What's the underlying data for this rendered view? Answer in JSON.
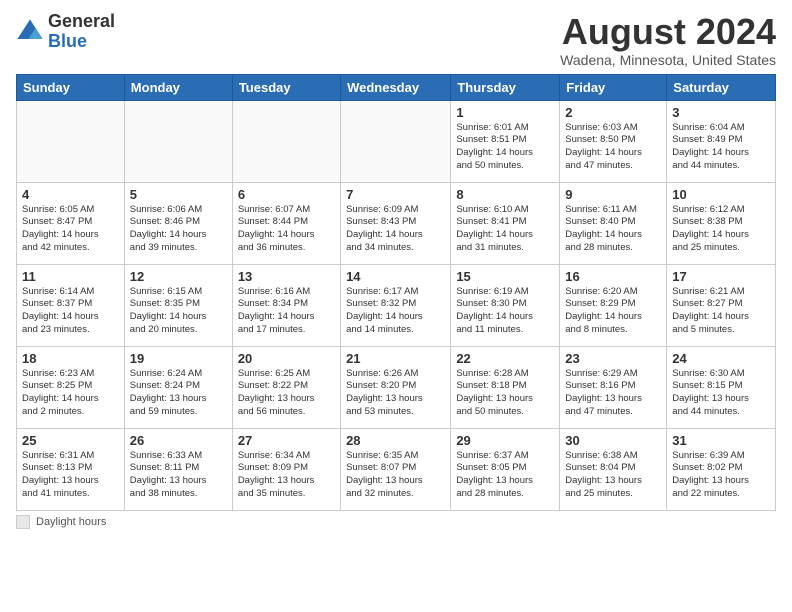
{
  "header": {
    "logo_general": "General",
    "logo_blue": "Blue",
    "month_title": "August 2024",
    "location": "Wadena, Minnesota, United States"
  },
  "days_of_week": [
    "Sunday",
    "Monday",
    "Tuesday",
    "Wednesday",
    "Thursday",
    "Friday",
    "Saturday"
  ],
  "footer": {
    "label": "Daylight hours"
  },
  "weeks": [
    [
      {
        "day": "",
        "info": ""
      },
      {
        "day": "",
        "info": ""
      },
      {
        "day": "",
        "info": ""
      },
      {
        "day": "",
        "info": ""
      },
      {
        "day": "1",
        "info": "Sunrise: 6:01 AM\nSunset: 8:51 PM\nDaylight: 14 hours\nand 50 minutes."
      },
      {
        "day": "2",
        "info": "Sunrise: 6:03 AM\nSunset: 8:50 PM\nDaylight: 14 hours\nand 47 minutes."
      },
      {
        "day": "3",
        "info": "Sunrise: 6:04 AM\nSunset: 8:49 PM\nDaylight: 14 hours\nand 44 minutes."
      }
    ],
    [
      {
        "day": "4",
        "info": "Sunrise: 6:05 AM\nSunset: 8:47 PM\nDaylight: 14 hours\nand 42 minutes."
      },
      {
        "day": "5",
        "info": "Sunrise: 6:06 AM\nSunset: 8:46 PM\nDaylight: 14 hours\nand 39 minutes."
      },
      {
        "day": "6",
        "info": "Sunrise: 6:07 AM\nSunset: 8:44 PM\nDaylight: 14 hours\nand 36 minutes."
      },
      {
        "day": "7",
        "info": "Sunrise: 6:09 AM\nSunset: 8:43 PM\nDaylight: 14 hours\nand 34 minutes."
      },
      {
        "day": "8",
        "info": "Sunrise: 6:10 AM\nSunset: 8:41 PM\nDaylight: 14 hours\nand 31 minutes."
      },
      {
        "day": "9",
        "info": "Sunrise: 6:11 AM\nSunset: 8:40 PM\nDaylight: 14 hours\nand 28 minutes."
      },
      {
        "day": "10",
        "info": "Sunrise: 6:12 AM\nSunset: 8:38 PM\nDaylight: 14 hours\nand 25 minutes."
      }
    ],
    [
      {
        "day": "11",
        "info": "Sunrise: 6:14 AM\nSunset: 8:37 PM\nDaylight: 14 hours\nand 23 minutes."
      },
      {
        "day": "12",
        "info": "Sunrise: 6:15 AM\nSunset: 8:35 PM\nDaylight: 14 hours\nand 20 minutes."
      },
      {
        "day": "13",
        "info": "Sunrise: 6:16 AM\nSunset: 8:34 PM\nDaylight: 14 hours\nand 17 minutes."
      },
      {
        "day": "14",
        "info": "Sunrise: 6:17 AM\nSunset: 8:32 PM\nDaylight: 14 hours\nand 14 minutes."
      },
      {
        "day": "15",
        "info": "Sunrise: 6:19 AM\nSunset: 8:30 PM\nDaylight: 14 hours\nand 11 minutes."
      },
      {
        "day": "16",
        "info": "Sunrise: 6:20 AM\nSunset: 8:29 PM\nDaylight: 14 hours\nand 8 minutes."
      },
      {
        "day": "17",
        "info": "Sunrise: 6:21 AM\nSunset: 8:27 PM\nDaylight: 14 hours\nand 5 minutes."
      }
    ],
    [
      {
        "day": "18",
        "info": "Sunrise: 6:23 AM\nSunset: 8:25 PM\nDaylight: 14 hours\nand 2 minutes."
      },
      {
        "day": "19",
        "info": "Sunrise: 6:24 AM\nSunset: 8:24 PM\nDaylight: 13 hours\nand 59 minutes."
      },
      {
        "day": "20",
        "info": "Sunrise: 6:25 AM\nSunset: 8:22 PM\nDaylight: 13 hours\nand 56 minutes."
      },
      {
        "day": "21",
        "info": "Sunrise: 6:26 AM\nSunset: 8:20 PM\nDaylight: 13 hours\nand 53 minutes."
      },
      {
        "day": "22",
        "info": "Sunrise: 6:28 AM\nSunset: 8:18 PM\nDaylight: 13 hours\nand 50 minutes."
      },
      {
        "day": "23",
        "info": "Sunrise: 6:29 AM\nSunset: 8:16 PM\nDaylight: 13 hours\nand 47 minutes."
      },
      {
        "day": "24",
        "info": "Sunrise: 6:30 AM\nSunset: 8:15 PM\nDaylight: 13 hours\nand 44 minutes."
      }
    ],
    [
      {
        "day": "25",
        "info": "Sunrise: 6:31 AM\nSunset: 8:13 PM\nDaylight: 13 hours\nand 41 minutes."
      },
      {
        "day": "26",
        "info": "Sunrise: 6:33 AM\nSunset: 8:11 PM\nDaylight: 13 hours\nand 38 minutes."
      },
      {
        "day": "27",
        "info": "Sunrise: 6:34 AM\nSunset: 8:09 PM\nDaylight: 13 hours\nand 35 minutes."
      },
      {
        "day": "28",
        "info": "Sunrise: 6:35 AM\nSunset: 8:07 PM\nDaylight: 13 hours\nand 32 minutes."
      },
      {
        "day": "29",
        "info": "Sunrise: 6:37 AM\nSunset: 8:05 PM\nDaylight: 13 hours\nand 28 minutes."
      },
      {
        "day": "30",
        "info": "Sunrise: 6:38 AM\nSunset: 8:04 PM\nDaylight: 13 hours\nand 25 minutes."
      },
      {
        "day": "31",
        "info": "Sunrise: 6:39 AM\nSunset: 8:02 PM\nDaylight: 13 hours\nand 22 minutes."
      }
    ]
  ]
}
